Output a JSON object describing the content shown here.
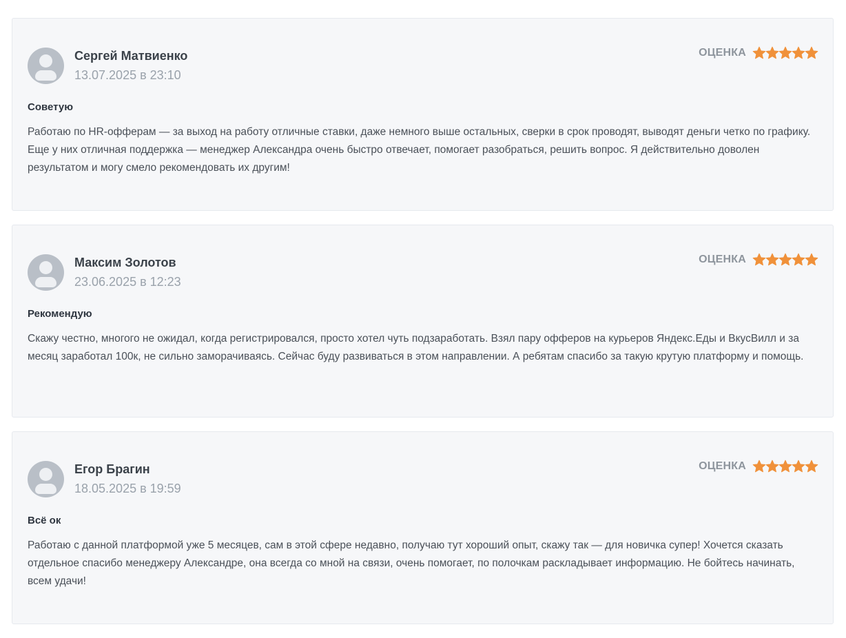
{
  "colors": {
    "card_background": "#f6f7f9",
    "card_border": "#e6e9ee",
    "star": "#f0913a",
    "avatar": "#b9bfc7",
    "date_text": "#9aa2ab",
    "rating_label": "#8e959d"
  },
  "icons": {
    "avatar": "user-avatar-icon",
    "star": "star-icon"
  },
  "reviews": [
    {
      "author": "Сергей Матвиенко",
      "date": "13.07.2025 в 23:10",
      "rating_label": "ОЦЕНКА",
      "rating": 5,
      "rating_max": 5,
      "title": "Советую",
      "text": "Работаю по HR-офферам — за выход на работу отличные ставки, даже немного выше остальных, сверки в срок проводят, выводят деньги четко по графику. Еще у них отличная поддержка — менеджер Александра очень быстро отвечает, помогает разобраться, решить вопрос. Я действительно доволен результатом и могу смело рекомендовать их другим!"
    },
    {
      "author": "Максим Золотов",
      "date": "23.06.2025 в 12:23",
      "rating_label": "ОЦЕНКА",
      "rating": 5,
      "rating_max": 5,
      "title": "Рекомендую",
      "text": "Скажу честно, многого не ожидал, когда регистрировался, просто хотел чуть подзаработать. Взял пару офферов на курьеров Яндекс.Еды и ВкусВилл и за месяц заработал 100к, не сильно заморачиваясь. Сейчас буду развиваться в этом направлении. А ребятам спасибо за такую крутую платформу и помощь."
    },
    {
      "author": "Егор Брагин",
      "date": "18.05.2025 в 19:59",
      "rating_label": "ОЦЕНКА",
      "rating": 5,
      "rating_max": 5,
      "title": "Всё ок",
      "text": "Работаю с данной платформой уже 5 месяцев, сам в этой сфере недавно, получаю тут хороший опыт, скажу так — для новичка супер! Хочется сказать отдельное спасибо менеджеру Александре, она всегда со мной на связи, очень помогает, по полочкам раскладывает информацию. Не бойтесь начинать, всем удачи!"
    }
  ]
}
